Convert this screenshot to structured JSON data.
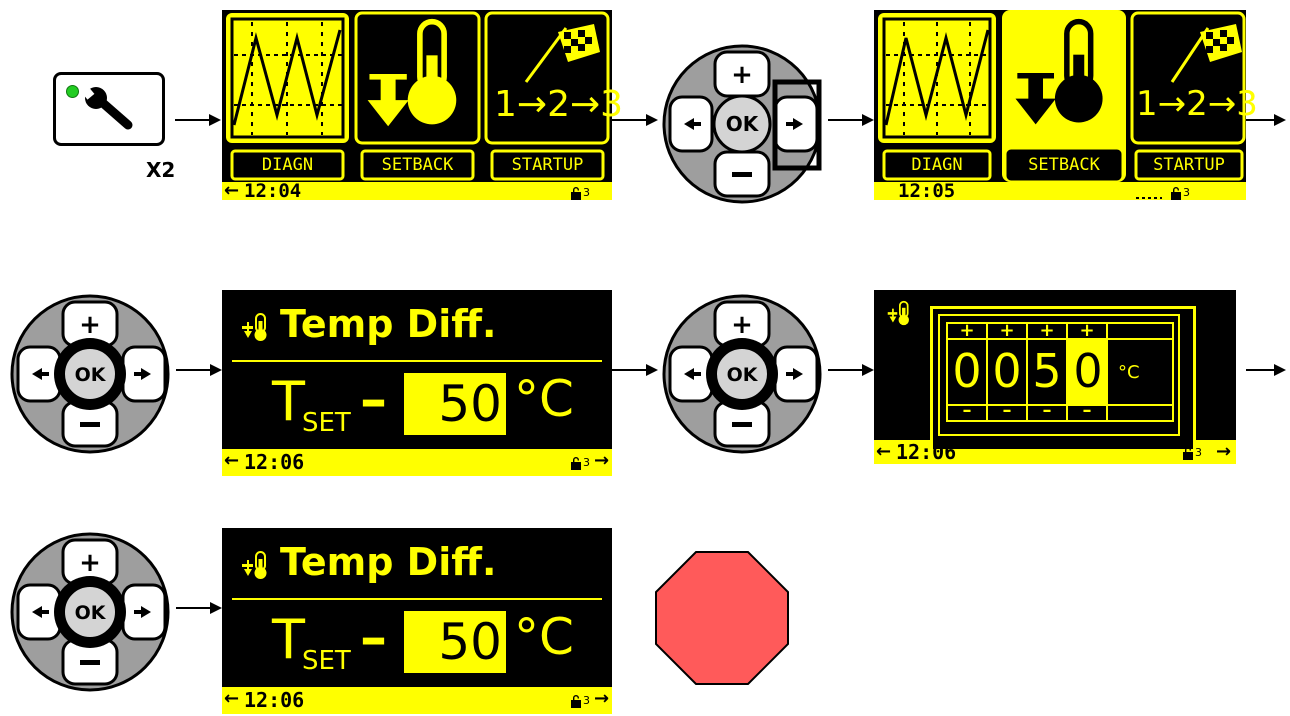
{
  "colors": {
    "lcd_yellow": "#ffff00",
    "lcd_black": "#000000",
    "dpad_gray": "#9e9e9e",
    "ok_gray": "#d4d4d4",
    "stop_red": "#ff5a5a",
    "led_green": "#22cc22"
  },
  "step1": {
    "icon": "wrench-icon",
    "repeat_label": "X2"
  },
  "menu_screen_1": {
    "items": [
      {
        "icon": "waveform-icon",
        "label": "DIAGN"
      },
      {
        "icon": "thermometer-down-icon",
        "label": "SETBACK"
      },
      {
        "icon": "checkered-flag-icon",
        "label": "STARTUP",
        "sequence": "1→2→3"
      }
    ],
    "status": {
      "left_arrow": "←",
      "time": "12:04",
      "lock_level": "3"
    }
  },
  "dpad": {
    "ok_label": "OK",
    "plus": "+",
    "minus": "–",
    "left": "←",
    "right": "→"
  },
  "menu_screen_2": {
    "items": [
      {
        "icon": "waveform-icon",
        "label": "DIAGN"
      },
      {
        "icon": "thermometer-down-icon",
        "label": "SETBACK",
        "selected": true
      },
      {
        "icon": "checkered-flag-icon",
        "label": "STARTUP",
        "sequence": "1→2→3"
      }
    ],
    "status": {
      "time": "12:05",
      "lock_level": "3"
    }
  },
  "temp_screen_1": {
    "title": "Temp Diff.",
    "t_label": "T",
    "t_sub": "SET",
    "dash": "–",
    "value": "50",
    "unit": "°C",
    "status": {
      "left_arrow": "←",
      "time": "12:06",
      "lock_level": "3",
      "right_arrow": "→"
    }
  },
  "edit_screen": {
    "digits": [
      "0",
      "0",
      "5",
      "0"
    ],
    "plus": "+",
    "minus": "–",
    "unit": "°C",
    "status": {
      "left_arrow": "←",
      "time": "12:06",
      "lock_level": "3",
      "right_arrow": "→"
    }
  },
  "temp_screen_2": {
    "title": "Temp Diff.",
    "t_label": "T",
    "t_sub": "SET",
    "dash": "–",
    "value": "50",
    "unit": "°C",
    "status": {
      "left_arrow": "←",
      "time": "12:06",
      "lock_level": "3",
      "right_arrow": "→"
    }
  },
  "stop": {
    "shape": "octagon"
  }
}
